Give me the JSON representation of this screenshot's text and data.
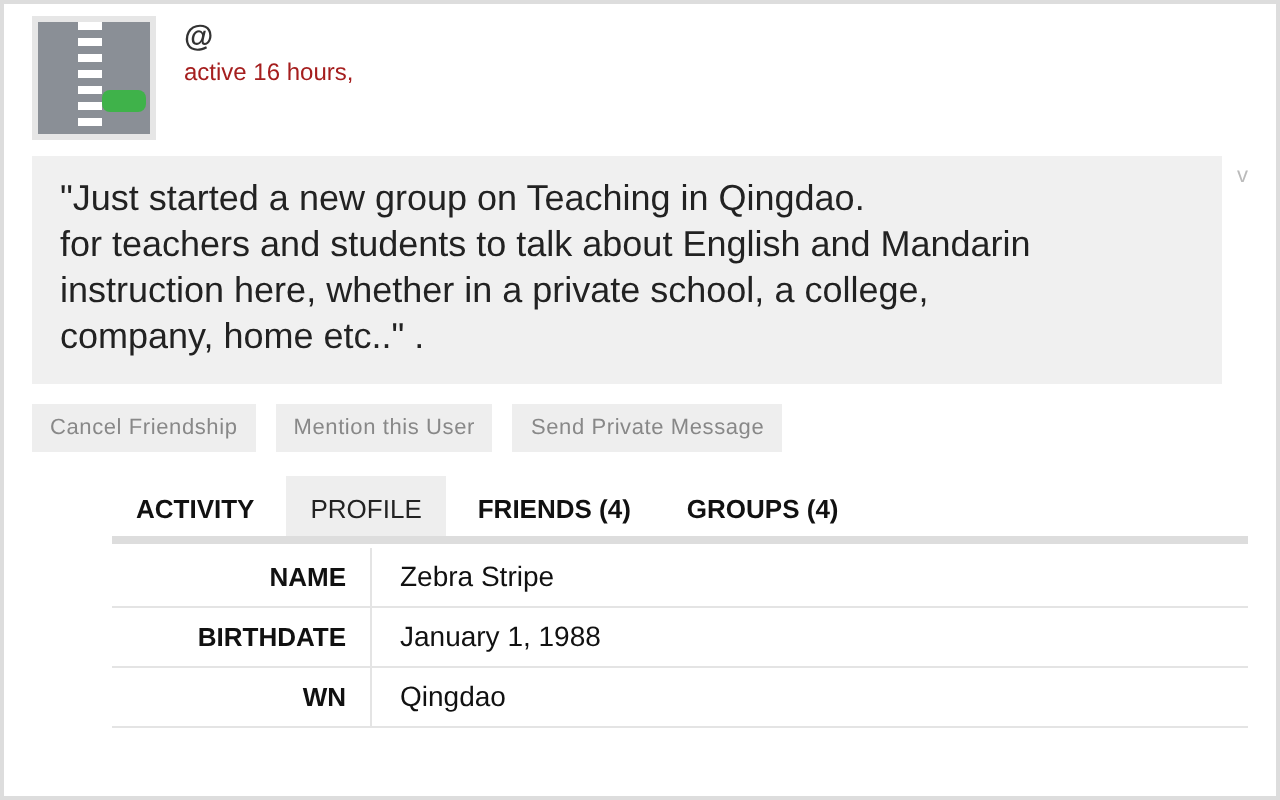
{
  "profile": {
    "handle": "@",
    "activity": "active 16 hours,"
  },
  "update": {
    "lines": [
      "\"Just started a new group on Teaching in Qingdao.",
      "for teachers and students to talk about English and Mandarin",
      "instruction here, whether in a private school, a college,",
      "company, home etc..\" ."
    ],
    "side_text": "v"
  },
  "actions": [
    "Cancel Friendship",
    "Mention this User",
    "Send Private Message"
  ],
  "tabs": [
    {
      "label": "ACTIVITY",
      "selected": false
    },
    {
      "label": "PROFILE",
      "selected": true
    },
    {
      "label": "FRIENDS (4)",
      "selected": false
    },
    {
      "label": "GROUPS (4)",
      "selected": false
    }
  ],
  "fields": [
    {
      "label": "NAME",
      "value": "Zebra Stripe"
    },
    {
      "label": "BIRTHDATE",
      "value": "January 1, 1988"
    },
    {
      "label": "WN",
      "value": "Qingdao"
    }
  ]
}
